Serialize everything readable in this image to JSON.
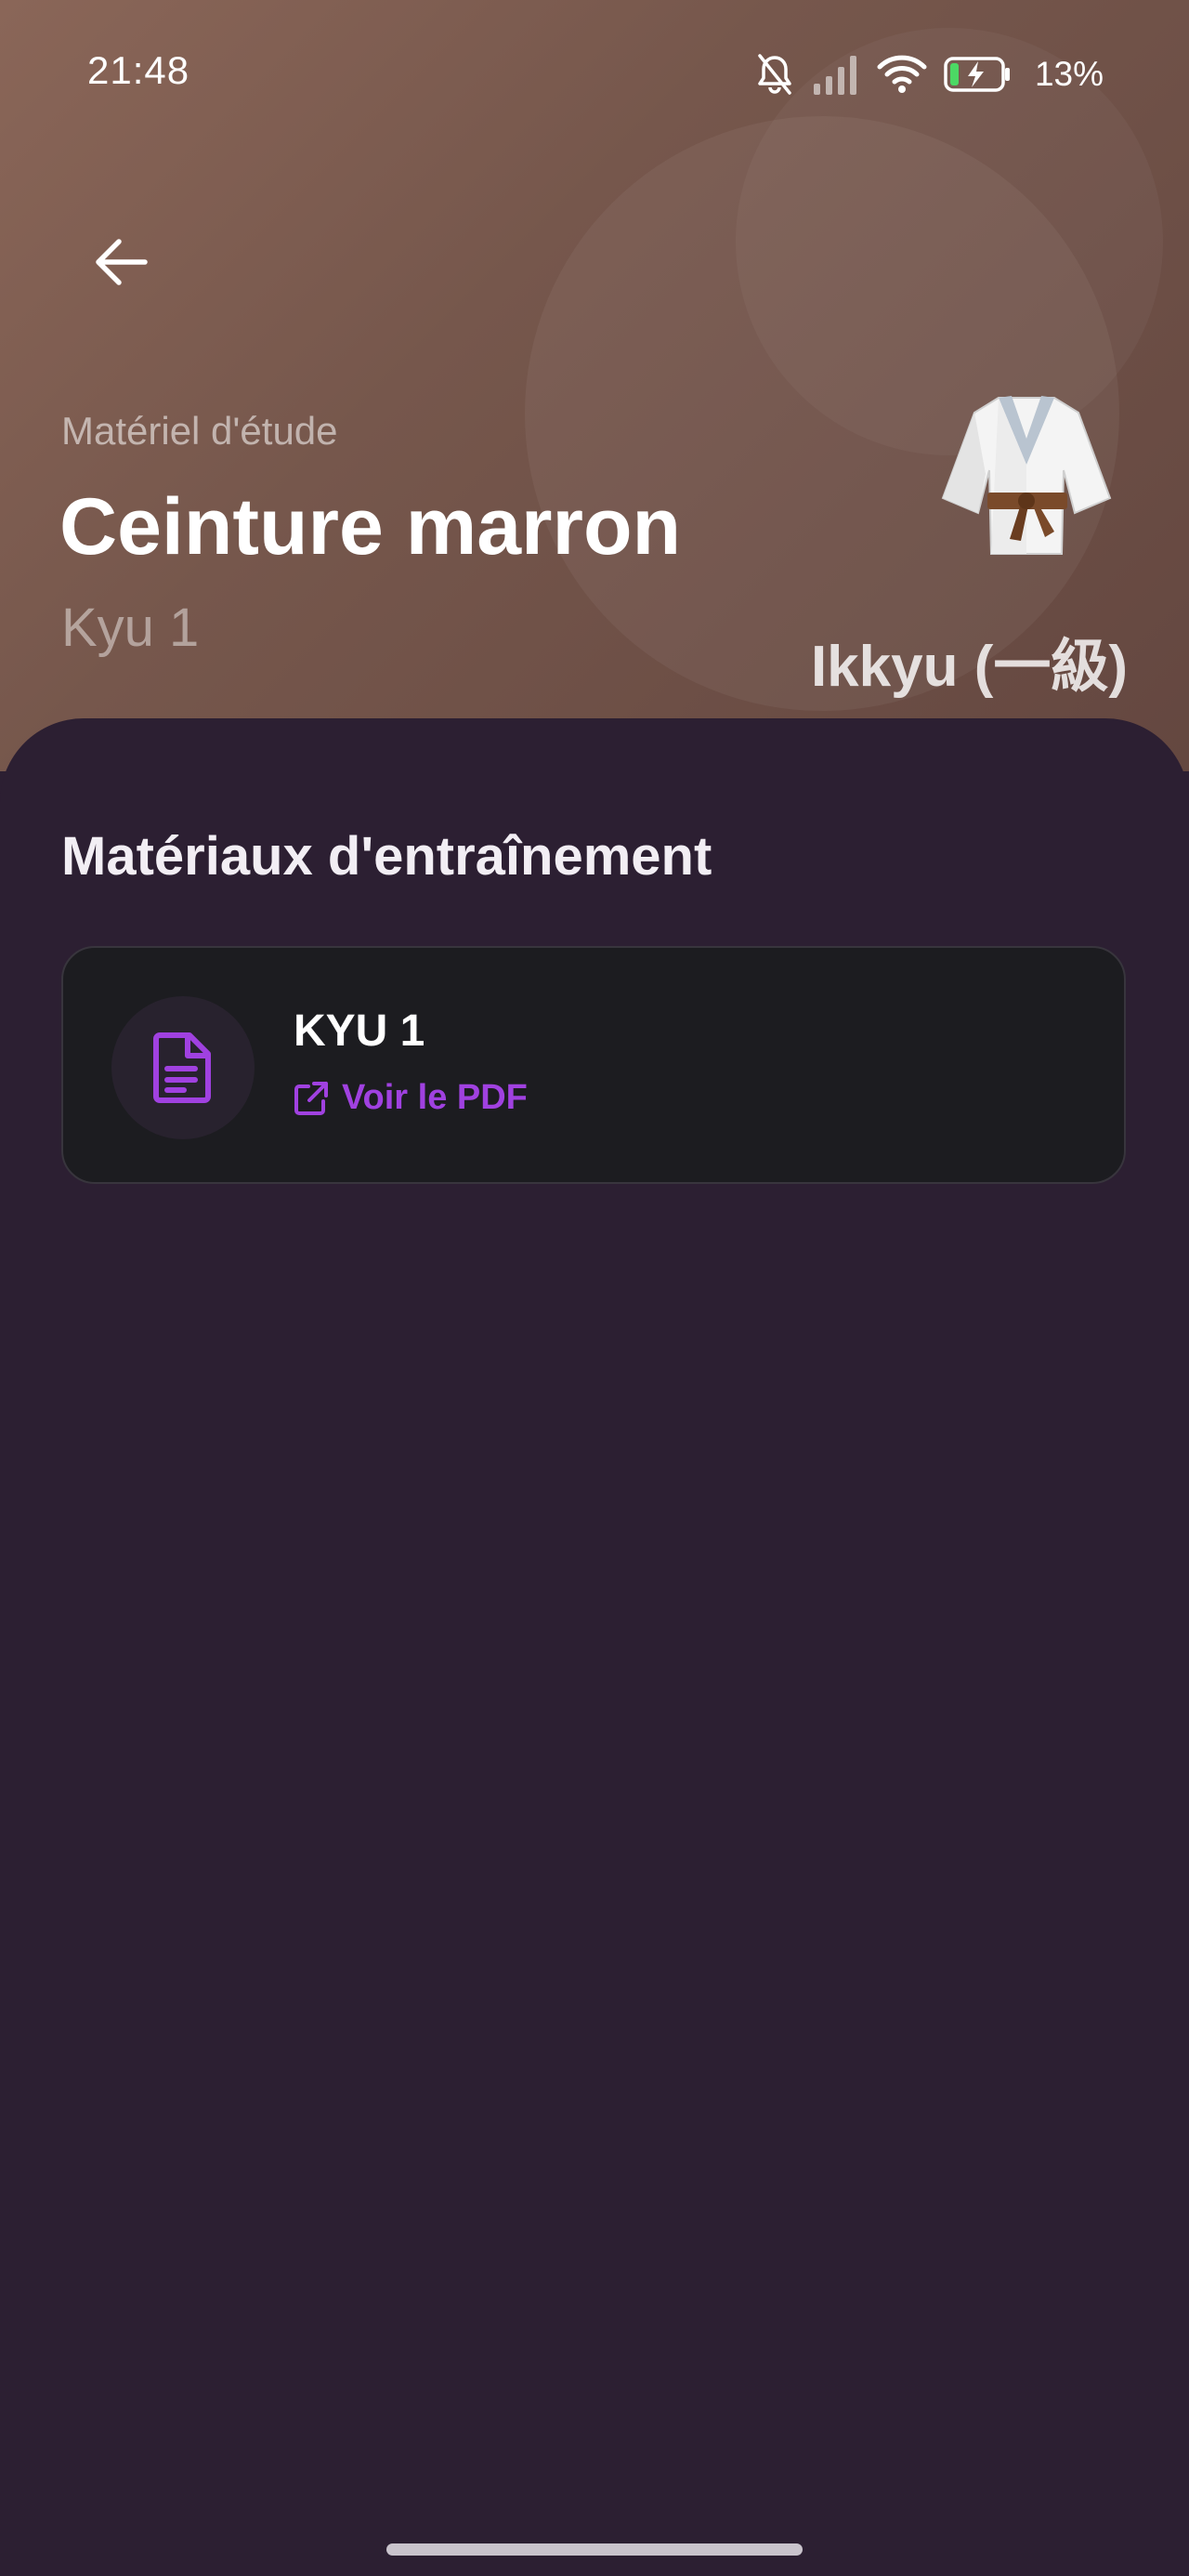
{
  "status_bar": {
    "time": "21:48",
    "battery_percent": "13%",
    "icons": [
      "bell-off-icon",
      "signal-icon",
      "wifi-icon",
      "battery-charging-icon"
    ]
  },
  "header": {
    "back_icon": "arrow-left-icon",
    "subtitle": "Matériel d'étude",
    "title": "Ceinture marron",
    "level": "Kyu 1",
    "japanese_name": "Ikkyu (一級)",
    "illustration": "martial-arts-uniform-icon",
    "colors": {
      "gradient_start": "#8a6658",
      "gradient_end": "#644740"
    }
  },
  "content": {
    "section_title": "Matériaux d'entraînement",
    "materials": [
      {
        "title": "KYU 1",
        "icon": "document-icon",
        "link_icon": "external-link-icon",
        "link_label": "Voir le PDF"
      }
    ],
    "colors": {
      "background": "#2c1f32",
      "card": "#1c1c20",
      "accent": "#a041e0"
    }
  }
}
